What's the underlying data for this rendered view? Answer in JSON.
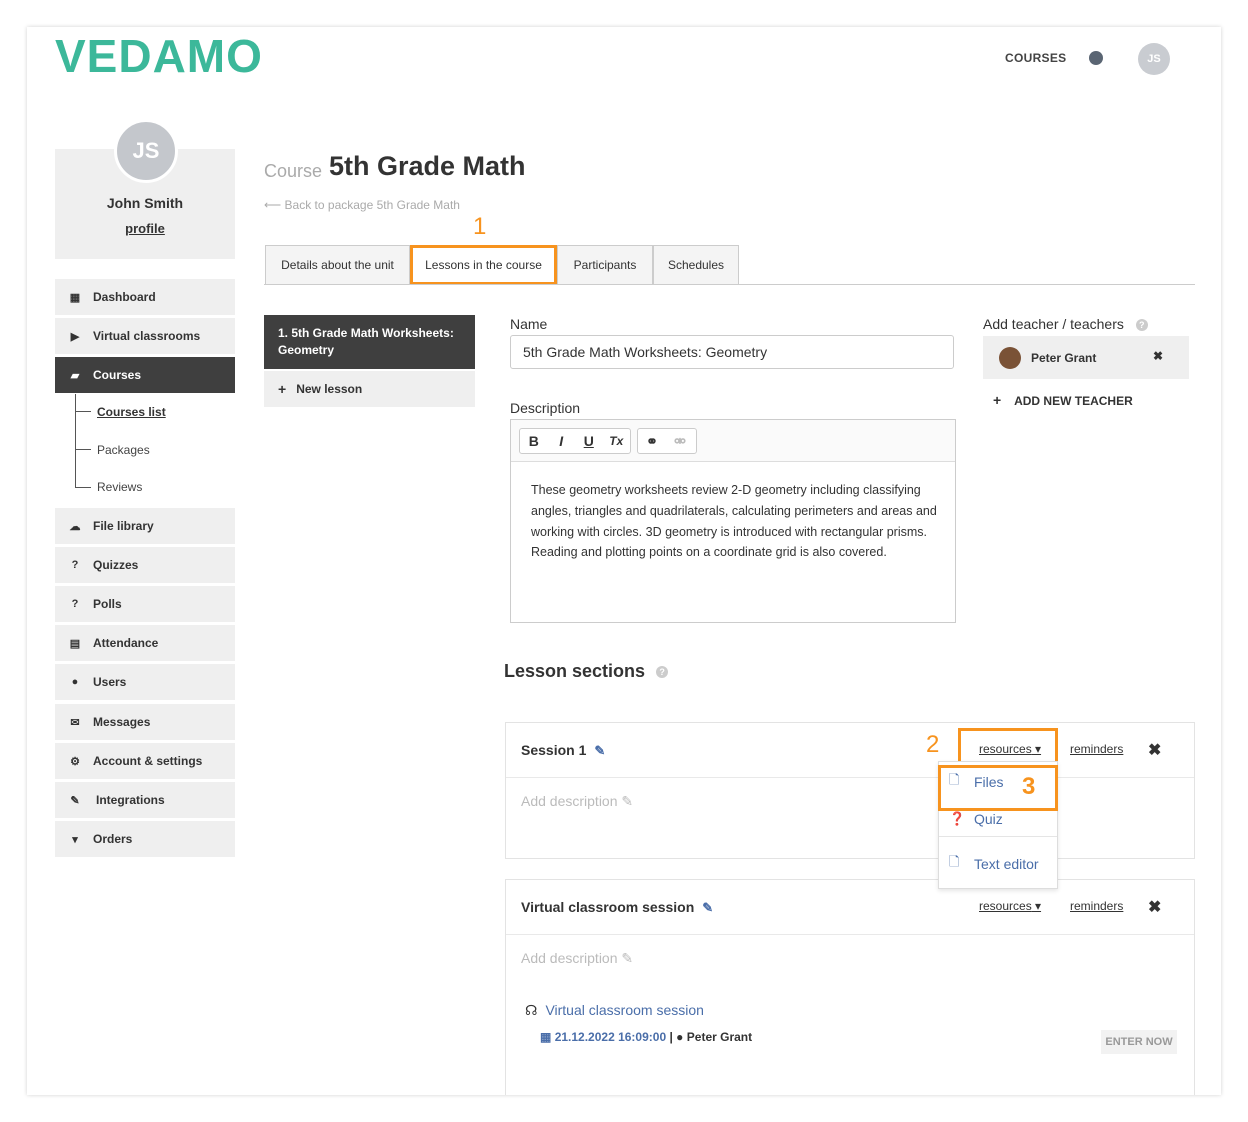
{
  "header": {
    "logo": "VEDAMO",
    "nav_courses": "COURSES",
    "user_initials": "JS"
  },
  "profile": {
    "initials": "JS",
    "name": "John Smith",
    "link": "profile"
  },
  "sidebar": {
    "items": [
      {
        "label": "Dashboard",
        "icon": "dashboard-icon"
      },
      {
        "label": "Virtual classrooms",
        "icon": "play-circle-icon"
      },
      {
        "label": "Courses",
        "icon": "book-icon"
      },
      {
        "label": "File library",
        "icon": "cloud-upload-icon"
      },
      {
        "label": "Quizzes",
        "icon": "question-circle-icon"
      },
      {
        "label": "Polls",
        "icon": "question-circle-icon"
      },
      {
        "label": "Attendance",
        "icon": "document-icon"
      },
      {
        "label": "Users",
        "icon": "users-icon"
      },
      {
        "label": "Messages",
        "icon": "envelope-icon"
      },
      {
        "label": "Account & settings",
        "icon": "gear-icon"
      },
      {
        "label": "Integrations",
        "icon": "plug-icon"
      },
      {
        "label": "Orders",
        "icon": "cart-icon"
      }
    ],
    "courses_sub": [
      "Courses list",
      "Packages",
      "Reviews"
    ]
  },
  "course": {
    "prefix": "Course",
    "title": "5th Grade Math",
    "back_link": "⟵ Back to package 5th Grade Math"
  },
  "tabs": [
    "Details about the unit",
    "Lessons in the course",
    "Participants",
    "Schedules"
  ],
  "callouts": [
    "1",
    "2",
    "3"
  ],
  "lessons": {
    "active": "1. 5th Grade Math Worksheets: Geometry",
    "new_lesson": "New lesson"
  },
  "form": {
    "name_label": "Name",
    "name_value": "5th Grade Math Worksheets: Geometry",
    "description_label": "Description",
    "description_text": "These geometry worksheets review 2-D geometry including classifying angles, triangles and quadrilaterals, calculating perimeters and areas and working with circles. 3D geometry is introduced with rectangular prisms.  Reading and plotting points on a coordinate grid is also covered.",
    "toolbar": [
      "B",
      "I",
      "U",
      "Tx"
    ]
  },
  "teachers": {
    "label": "Add teacher / teachers",
    "items": [
      "Peter Grant"
    ],
    "add_label": "ADD NEW TEACHER"
  },
  "sections": {
    "title": "Lesson sections",
    "resources_label": "resources",
    "reminders_label": "reminders",
    "add_description": "Add description",
    "items": [
      {
        "name": "Session 1"
      },
      {
        "name": "Virtual classroom session"
      }
    ],
    "dropdown": [
      {
        "label": "Files",
        "icon": "file-icon"
      },
      {
        "label": "Quiz",
        "icon": "question-circle-icon"
      },
      {
        "label": "Text editor",
        "icon": "file-icon"
      }
    ],
    "vc": {
      "link": "Virtual classroom session",
      "date": "21.12.2022 16:09:00",
      "sep": "|",
      "teacher": "Peter Grant",
      "enter": "ENTER NOW"
    }
  },
  "colors": {
    "brand": "#3cb89a",
    "accent_highlight": "#f7931e",
    "link": "#4a6ea9",
    "sidebar_active": "#3f3f3f"
  }
}
